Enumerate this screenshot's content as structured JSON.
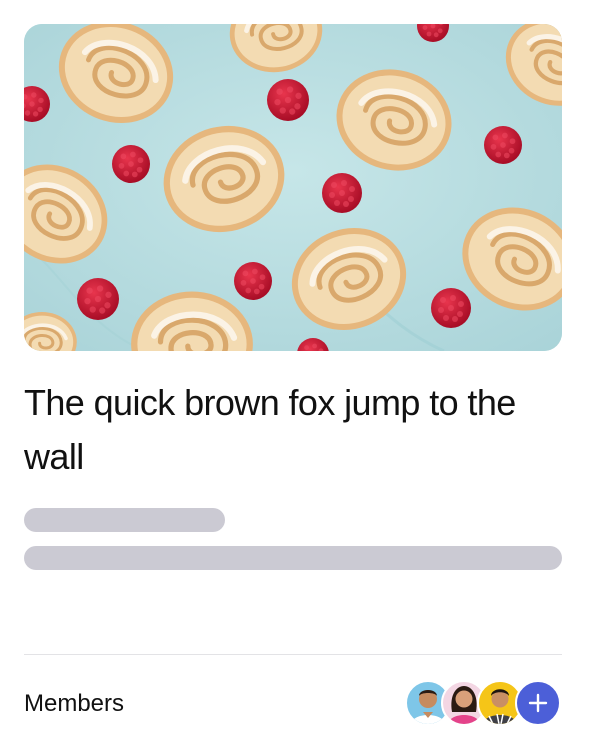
{
  "card": {
    "image_alt": "Swiss roll slices with raspberries",
    "title": "The quick brown fox jump to the wall",
    "members_label": "Members",
    "members": [
      {
        "name": "member-1",
        "bg": "#7ec6e8"
      },
      {
        "name": "member-2",
        "bg": "#f3d6e3"
      },
      {
        "name": "member-3",
        "bg": "#f5c518"
      }
    ],
    "add_member_icon": "plus-icon",
    "colors": {
      "skeleton": "#cbcad3",
      "accent": "#4c5fd8",
      "image_bg": "#b9dde0",
      "raspberry": "#c8102e",
      "cake": "#f0d3a6"
    }
  }
}
